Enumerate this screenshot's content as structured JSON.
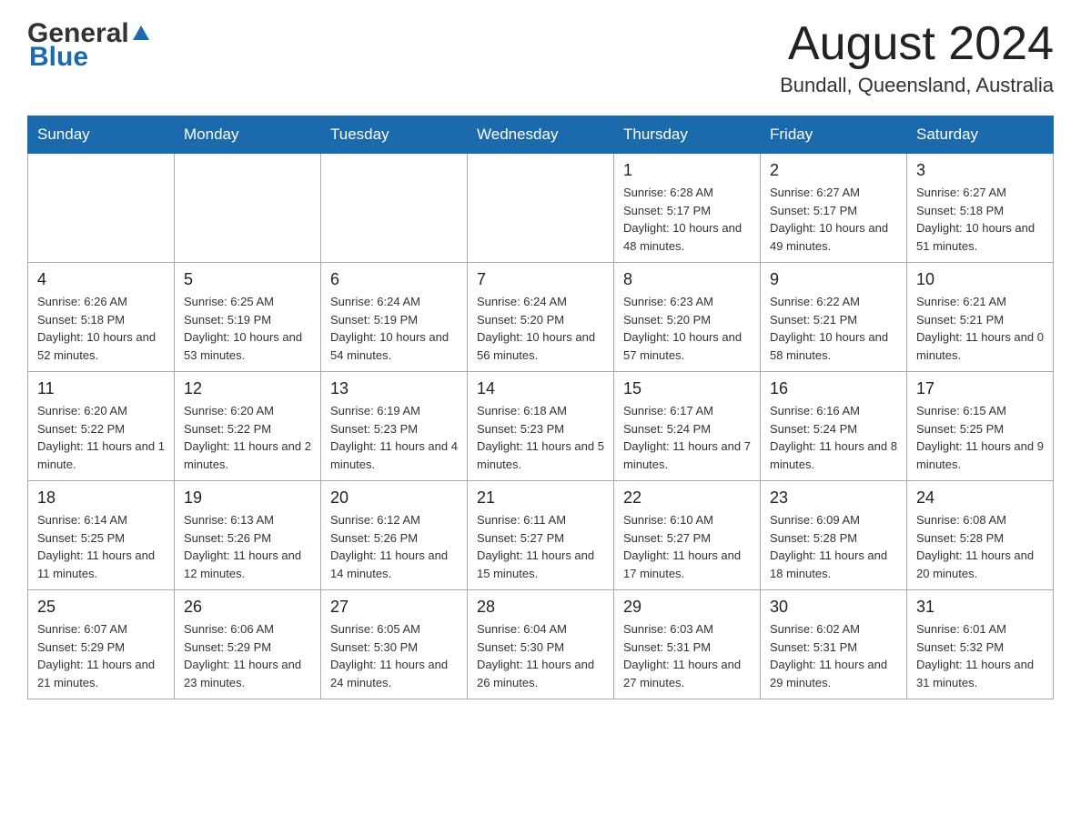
{
  "header": {
    "logo": {
      "general": "General",
      "blue": "Blue"
    },
    "title": "August 2024",
    "location": "Bundall, Queensland, Australia"
  },
  "calendar": {
    "days_of_week": [
      "Sunday",
      "Monday",
      "Tuesday",
      "Wednesday",
      "Thursday",
      "Friday",
      "Saturday"
    ],
    "weeks": [
      [
        {
          "day": "",
          "info": ""
        },
        {
          "day": "",
          "info": ""
        },
        {
          "day": "",
          "info": ""
        },
        {
          "day": "",
          "info": ""
        },
        {
          "day": "1",
          "info": "Sunrise: 6:28 AM\nSunset: 5:17 PM\nDaylight: 10 hours and 48 minutes."
        },
        {
          "day": "2",
          "info": "Sunrise: 6:27 AM\nSunset: 5:17 PM\nDaylight: 10 hours and 49 minutes."
        },
        {
          "day": "3",
          "info": "Sunrise: 6:27 AM\nSunset: 5:18 PM\nDaylight: 10 hours and 51 minutes."
        }
      ],
      [
        {
          "day": "4",
          "info": "Sunrise: 6:26 AM\nSunset: 5:18 PM\nDaylight: 10 hours and 52 minutes."
        },
        {
          "day": "5",
          "info": "Sunrise: 6:25 AM\nSunset: 5:19 PM\nDaylight: 10 hours and 53 minutes."
        },
        {
          "day": "6",
          "info": "Sunrise: 6:24 AM\nSunset: 5:19 PM\nDaylight: 10 hours and 54 minutes."
        },
        {
          "day": "7",
          "info": "Sunrise: 6:24 AM\nSunset: 5:20 PM\nDaylight: 10 hours and 56 minutes."
        },
        {
          "day": "8",
          "info": "Sunrise: 6:23 AM\nSunset: 5:20 PM\nDaylight: 10 hours and 57 minutes."
        },
        {
          "day": "9",
          "info": "Sunrise: 6:22 AM\nSunset: 5:21 PM\nDaylight: 10 hours and 58 minutes."
        },
        {
          "day": "10",
          "info": "Sunrise: 6:21 AM\nSunset: 5:21 PM\nDaylight: 11 hours and 0 minutes."
        }
      ],
      [
        {
          "day": "11",
          "info": "Sunrise: 6:20 AM\nSunset: 5:22 PM\nDaylight: 11 hours and 1 minute."
        },
        {
          "day": "12",
          "info": "Sunrise: 6:20 AM\nSunset: 5:22 PM\nDaylight: 11 hours and 2 minutes."
        },
        {
          "day": "13",
          "info": "Sunrise: 6:19 AM\nSunset: 5:23 PM\nDaylight: 11 hours and 4 minutes."
        },
        {
          "day": "14",
          "info": "Sunrise: 6:18 AM\nSunset: 5:23 PM\nDaylight: 11 hours and 5 minutes."
        },
        {
          "day": "15",
          "info": "Sunrise: 6:17 AM\nSunset: 5:24 PM\nDaylight: 11 hours and 7 minutes."
        },
        {
          "day": "16",
          "info": "Sunrise: 6:16 AM\nSunset: 5:24 PM\nDaylight: 11 hours and 8 minutes."
        },
        {
          "day": "17",
          "info": "Sunrise: 6:15 AM\nSunset: 5:25 PM\nDaylight: 11 hours and 9 minutes."
        }
      ],
      [
        {
          "day": "18",
          "info": "Sunrise: 6:14 AM\nSunset: 5:25 PM\nDaylight: 11 hours and 11 minutes."
        },
        {
          "day": "19",
          "info": "Sunrise: 6:13 AM\nSunset: 5:26 PM\nDaylight: 11 hours and 12 minutes."
        },
        {
          "day": "20",
          "info": "Sunrise: 6:12 AM\nSunset: 5:26 PM\nDaylight: 11 hours and 14 minutes."
        },
        {
          "day": "21",
          "info": "Sunrise: 6:11 AM\nSunset: 5:27 PM\nDaylight: 11 hours and 15 minutes."
        },
        {
          "day": "22",
          "info": "Sunrise: 6:10 AM\nSunset: 5:27 PM\nDaylight: 11 hours and 17 minutes."
        },
        {
          "day": "23",
          "info": "Sunrise: 6:09 AM\nSunset: 5:28 PM\nDaylight: 11 hours and 18 minutes."
        },
        {
          "day": "24",
          "info": "Sunrise: 6:08 AM\nSunset: 5:28 PM\nDaylight: 11 hours and 20 minutes."
        }
      ],
      [
        {
          "day": "25",
          "info": "Sunrise: 6:07 AM\nSunset: 5:29 PM\nDaylight: 11 hours and 21 minutes."
        },
        {
          "day": "26",
          "info": "Sunrise: 6:06 AM\nSunset: 5:29 PM\nDaylight: 11 hours and 23 minutes."
        },
        {
          "day": "27",
          "info": "Sunrise: 6:05 AM\nSunset: 5:30 PM\nDaylight: 11 hours and 24 minutes."
        },
        {
          "day": "28",
          "info": "Sunrise: 6:04 AM\nSunset: 5:30 PM\nDaylight: 11 hours and 26 minutes."
        },
        {
          "day": "29",
          "info": "Sunrise: 6:03 AM\nSunset: 5:31 PM\nDaylight: 11 hours and 27 minutes."
        },
        {
          "day": "30",
          "info": "Sunrise: 6:02 AM\nSunset: 5:31 PM\nDaylight: 11 hours and 29 minutes."
        },
        {
          "day": "31",
          "info": "Sunrise: 6:01 AM\nSunset: 5:32 PM\nDaylight: 11 hours and 31 minutes."
        }
      ]
    ]
  }
}
